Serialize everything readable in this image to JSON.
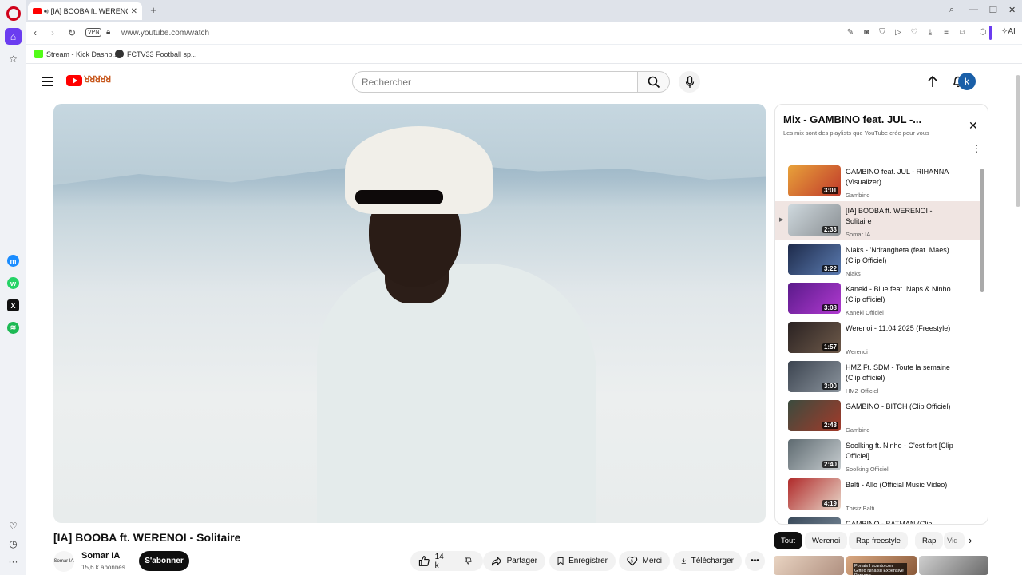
{
  "browser": {
    "tab_title": "[IA] BOOBA ft. WERENO",
    "url": "www.youtube.com/watch",
    "vpn_label": "VPN",
    "ai_label": "AI",
    "bookmarks": [
      {
        "label": "Stream - Kick Dashb...",
        "icon": "kick-icon",
        "color": "#53fc18"
      },
      {
        "label": "FCTV33 Football sp...",
        "icon": "fctv-icon",
        "color": "#333333"
      }
    ]
  },
  "youtube": {
    "search_placeholder": "Rechercher",
    "avatar_letter": "k",
    "video": {
      "title": "[IA] BOOBA ft. WERENOI - Solitaire",
      "channel": "Somar IA",
      "channel_avatar_text": "Somar IA",
      "subscribers": "15,6 k abonnés",
      "subscribe_label": "S'abonner",
      "likes": "14 k",
      "share_label": "Partager",
      "save_label": "Enregistrer",
      "thanks_label": "Merci",
      "download_label": "Télécharger"
    },
    "playlist": {
      "title": "Mix - GAMBINO feat. JUL -...",
      "subtitle": "Les mix sont des playlists que YouTube crée pour vous",
      "items": [
        {
          "title": "GAMBINO feat. JUL - RIHANNA (Visualizer)",
          "channel": "Gambino",
          "duration": "3:01",
          "thumb": "linear-gradient(135deg,#e8a23a,#c0392b)",
          "active": false
        },
        {
          "title": "[IA] BOOBA ft. WERENOI - Solitaire",
          "channel": "Somar IA",
          "duration": "2:33",
          "thumb": "linear-gradient(135deg,#cfd9de,#8a8f93)",
          "active": true
        },
        {
          "title": "Niaks - 'Ndrangheta (feat. Maes) (Clip Officiel)",
          "channel": "Niaks",
          "duration": "3:22",
          "thumb": "linear-gradient(135deg,#1d2a4a,#5b7bb0)",
          "active": false
        },
        {
          "title": "Kaneki - Blue feat. Naps & Ninho (Clip officiel)",
          "channel": "Kaneki Officiel",
          "duration": "3:08",
          "thumb": "linear-gradient(135deg,#5a1a8a,#b03ad0)",
          "active": false
        },
        {
          "title": "Werenoi - 11.04.2025 (Freestyle)",
          "channel": "Werenoi",
          "duration": "1:57",
          "thumb": "linear-gradient(135deg,#2a2222,#6e5a4a)",
          "active": false
        },
        {
          "title": "HMZ Ft. SDM - Toute la semaine (Clip officiel)",
          "channel": "HMZ Officiel",
          "duration": "3:00",
          "thumb": "linear-gradient(135deg,#3c4450,#8a939c)",
          "active": false
        },
        {
          "title": "GAMBINO - BITCH (Clip Officiel)",
          "channel": "Gambino",
          "duration": "2:48",
          "thumb": "linear-gradient(135deg,#3b4b3e,#a33a2a)",
          "active": false
        },
        {
          "title": "Soolking ft. Ninho - C'est fort [Clip Officiel]",
          "channel": "Soolking Officiel",
          "duration": "2:40",
          "thumb": "linear-gradient(135deg,#5e6a70,#c7cdd0)",
          "active": false
        },
        {
          "title": "Balti - Allo (Official Music Video)",
          "channel": "Thisiz Balti",
          "duration": "4:19",
          "thumb": "linear-gradient(135deg,#b02a2a,#e8d6c8)",
          "active": false
        },
        {
          "title": "GAMBINO - BATMAN (Clip",
          "channel": "",
          "duration": "",
          "thumb": "linear-gradient(135deg,#3a4a5a,#7a8a9a)",
          "active": false
        }
      ]
    },
    "chips": [
      "Tout",
      "Werenoi",
      "Rap freestyle",
      "Rap",
      "Vid"
    ],
    "recommend_caption": "Portais I scunto con Gifted Nina su Expensive Perfume"
  }
}
